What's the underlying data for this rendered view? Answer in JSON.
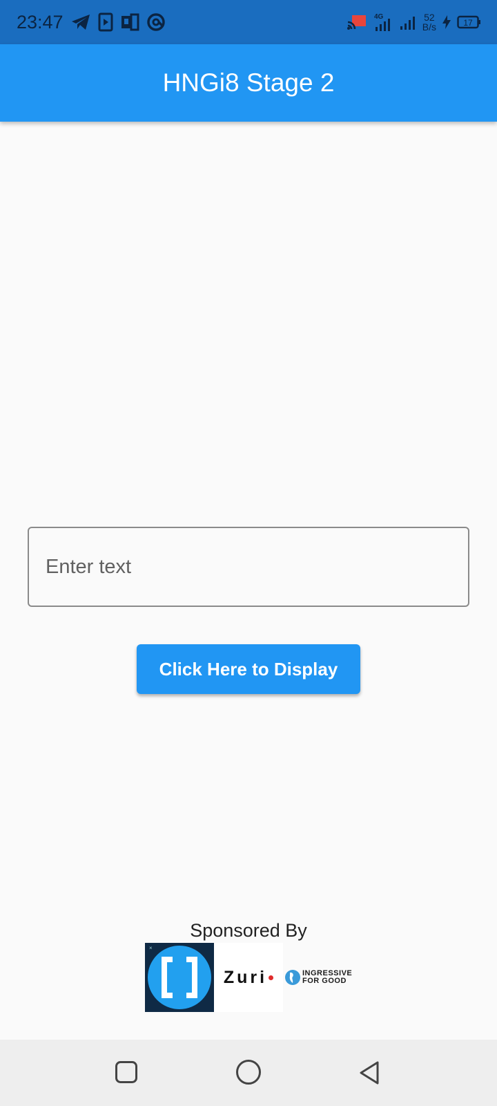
{
  "status_bar": {
    "time": "23:47",
    "net_speed_value": "52",
    "net_speed_unit": "B/s",
    "battery": "17",
    "network_type": "4G"
  },
  "app_bar": {
    "title": "HNGi8 Stage 2"
  },
  "form": {
    "input_placeholder": "Enter text",
    "input_value": "",
    "button_label": "Click Here to Display"
  },
  "footer": {
    "sponsored_label": "Sponsored By",
    "zuri_text": "Zuri",
    "ingressive_line1": "INGRESSIVE",
    "ingressive_line2": "FOR GOOD"
  },
  "colors": {
    "primary": "#2196f3",
    "status_bar": "#1a6dbf",
    "background": "#fafafa"
  }
}
